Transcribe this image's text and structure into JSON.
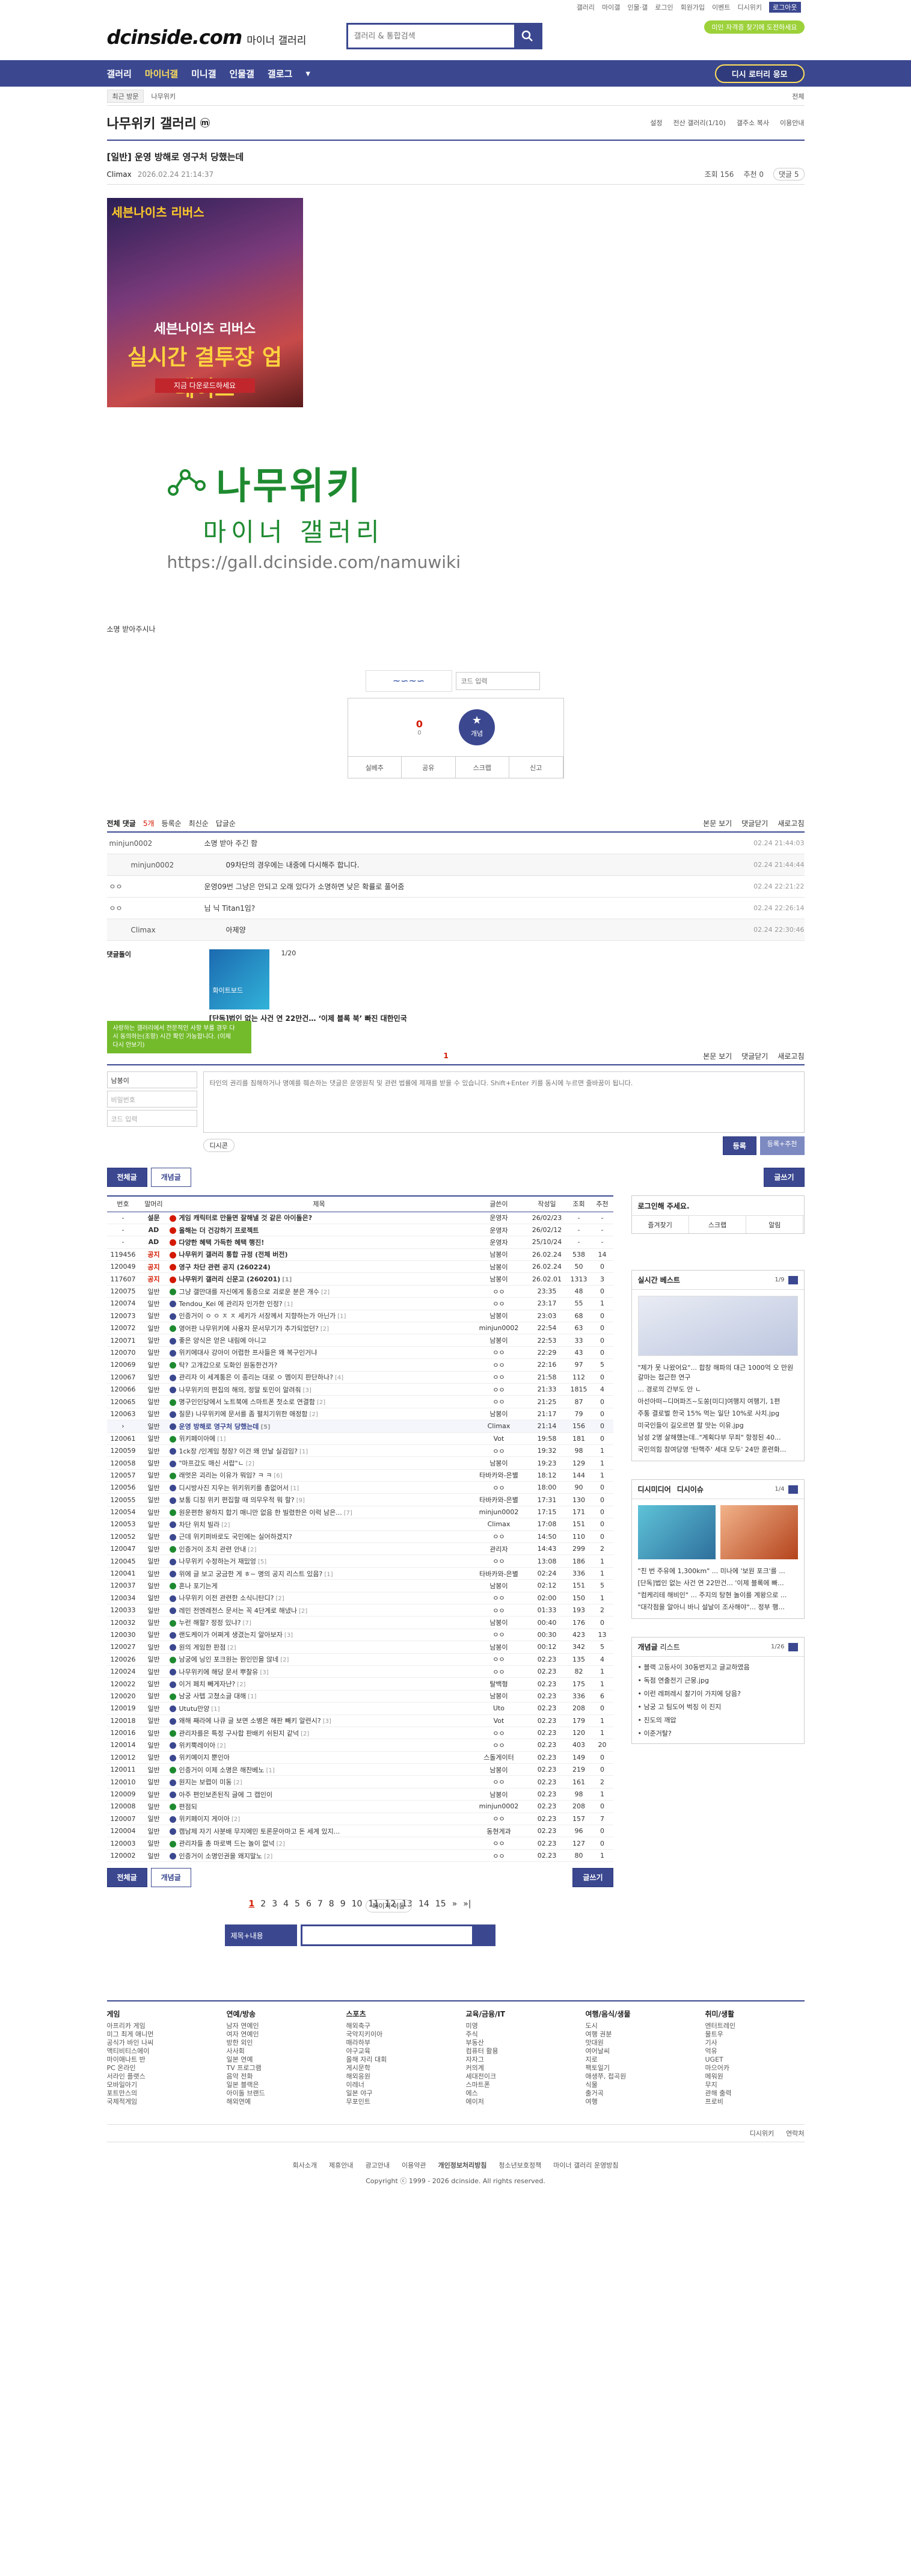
{
  "util": [
    "갤러리",
    "마이갤",
    "인물·갤",
    "로그인",
    "회원가입",
    "이벤트",
    "디시위키"
  ],
  "util_sel": "로그아웃",
  "logo": "dcinside.com",
  "logo_sub": "마이너 갤러리",
  "search_ph": "갤러리 & 통합검색",
  "pill": "미인 자격증 찾기에 도전하세요",
  "gnb": [
    "갤러리",
    "마이너갤",
    "미니갤",
    "인물갤",
    "갤로그"
  ],
  "gnb_btn": "디시 로터리 응모",
  "crumb": [
    "최근 방문",
    "나무위키"
  ],
  "crumb_r": "전체",
  "gallery": "나무위키 갤러리",
  "gallery_icon": "m",
  "gtools": [
    "설정",
    "전산 갤러리(1/10)",
    "갤주소 복사",
    "이용안내"
  ],
  "post": {
    "title": "[일반] 운영 방해로 영구처 당했는데",
    "writer": "Climax",
    "date": "2026.02.24 21:14:37",
    "views": "조회 156",
    "rec": "추천 0",
    "cmt": "댓글 5"
  },
  "ad": {
    "logo": "세븐나이츠 리버스",
    "t1": "세븐나이츠 리버스",
    "t2": "실시간 결투장 업데이트",
    "cta": "지금 다운로드하세요"
  },
  "nlogo": {
    "big": "나무위키",
    "mid": "마이너 갤러리",
    "url": "https://gall.dcinside.com/namuwiki"
  },
  "body": "소명 받아주시나",
  "captcha": "코드 입력",
  "recbox": {
    "up": "0",
    "up_sub": "0",
    "btn": "개념",
    "bar": [
      "실베추",
      "공유",
      "스크랩",
      "신고"
    ]
  },
  "chead": {
    "all": "전체 댓글",
    "count": "5개",
    "opts": [
      "등록순",
      "최신순",
      "답글순"
    ],
    "r": [
      "본문 보기",
      "댓글닫기",
      "새로고침"
    ]
  },
  "comments": [
    {
      "n": "minjun0002",
      "c": "소명 받아 주긴 함",
      "d": "02.24 21:44:03",
      "sub": false
    },
    {
      "n": "minjun0002",
      "c": "09차단의 경우에는 내중에 다시해주 합니다.",
      "d": "02.24 21:44:44",
      "sub": true
    },
    {
      "n": "ㅇㅇ",
      "c": "운영09번 그냥은 안되고 오래 있다가 소명하면 낮은 확률로 풀어줌",
      "d": "02.24 22:21:22",
      "sub": false
    },
    {
      "n": "ㅇㅇ",
      "c": "님 닉 Titan1임?",
      "d": "02.24 22:26:14",
      "sub": false
    },
    {
      "n": "Climax",
      "c": "아제양",
      "d": "02.24 22:30:46",
      "sub": true
    }
  ],
  "ans": {
    "lab": "댓글돌이",
    "thumb": "화이트보드",
    "pg": "1/20",
    "title": "[단독]법인 없는 사건 연 22만건… ‘이제 블록 북’ 빠진 대한민국"
  },
  "chead2": {
    "page": "1",
    "r": [
      "본문 보기",
      "댓글닫기",
      "새로고침"
    ],
    "tip": "사랑하는 갤러리에서 전문적인 사항 부를 경우 다시 동의하는(조항) 시간 확인 가능합니다. (이제 다시 안보기)"
  },
  "cwrite": {
    "nick": "남봉이",
    "pw": "비밀번호",
    "code": "코드 입력",
    "ph": "타인의 권리를 침해하거나 명예를 훼손하는 댓글은 운영원칙 및 관련 법률에 제재를 받을 수 있습니다. Shift+Enter 키를 동시에 누르면 줄바꿈이 됩니다.",
    "dcon": "디시콘",
    "submit": "등록",
    "submit2": "등록+추천"
  },
  "lbtn": {
    "all": "전체글",
    "concept": "개념글",
    "write": "글쓰기"
  },
  "thead": [
    "번호",
    "말머리",
    "제목",
    "글쓴이",
    "작성일",
    "조회",
    "추천"
  ],
  "rows": [
    [
      "-",
      "설문",
      "게임 캐릭터로 만들면 잘해낼 것 같은 아이돌은?",
      "",
      "운영자",
      "26/02/23",
      "-",
      "-",
      "notice"
    ],
    [
      "-",
      "AD",
      "올해는 더 건강하기 프로젝트",
      "",
      "운영자",
      "26/02/12",
      "-",
      "-",
      "notice"
    ],
    [
      "-",
      "AD",
      "다양한 혜택 가득한 혜택 행진!",
      "",
      "운영자",
      "25/10/24",
      "-",
      "-",
      "notice"
    ],
    [
      "119456",
      "공지",
      "나무위키 갤러리 통합 규정 (전체 버전)",
      "",
      "남봉이",
      "26.02.24",
      "538",
      "14",
      "notice"
    ],
    [
      "120049",
      "공지",
      "영구 차단 관련 공지 (260224)",
      "",
      "남봉이",
      "26.02.24",
      "50",
      "0",
      "notice"
    ],
    [
      "117607",
      "공지",
      "나무위키 갤러리 신문고 (260201)",
      "[1]",
      "남봉이",
      "26.02.01",
      "1313",
      "3",
      "notice"
    ],
    [
      "120075",
      "일반",
      "그냥 갤만대를 자신에게 통증으로 괴로운 분은 개수",
      "[2]",
      "ㅇㅇ",
      "23:35",
      "48",
      "0",
      ""
    ],
    [
      "120074",
      "일반",
      "Tendou_Kei 에 관리자 인가한 인정?",
      "[1]",
      "ㅇㅇ",
      "23:17",
      "55",
      "1",
      ""
    ],
    [
      "120073",
      "일반",
      "인증거이 ㅇ ㅇ ㅈ ㅈ 세키가 서장께서 지향하는가 아닌가",
      "[1]",
      "남봉이",
      "23:03",
      "68",
      "0",
      ""
    ],
    [
      "120072",
      "일반",
      "영어판 나무위키에 사용자 문서무기가 추가되었던?",
      "[2]",
      "minjun0002",
      "22:54",
      "63",
      "0",
      ""
    ],
    [
      "120071",
      "일반",
      "좋은 양식은 얻은 내림에 아니고",
      "",
      "남봉이",
      "22:53",
      "33",
      "0",
      ""
    ],
    [
      "120070",
      "일반",
      "위키에대사 강아이 어렵한 프사들은 왜 복구인거냐",
      "",
      "ㅇㅇ",
      "22:29",
      "43",
      "0",
      ""
    ],
    [
      "120069",
      "일반",
      "탁? 고개갔으로 도화인 원동한건가?",
      "",
      "ㅇㅇ",
      "22:16",
      "97",
      "5",
      ""
    ],
    [
      "120067",
      "일반",
      "관리자 이 세계통은 이 종리는 대로 ㅇ 멤이지 판단하나?",
      "[4]",
      "ㅇㅇ",
      "21:58",
      "112",
      "0",
      ""
    ],
    [
      "120066",
      "일반",
      "나무위키의 편집의 해의, 정말 토민이 알려줘",
      "[3]",
      "ㅇㅇ",
      "21:33",
      "1815",
      "4",
      ""
    ],
    [
      "120065",
      "일반",
      "명구인인당에서 노트북에 스마트폰 첫소로 연결함",
      "[2]",
      "ㅇㅇ",
      "21:25",
      "87",
      "0",
      ""
    ],
    [
      "120063",
      "일반",
      "질문) 나무위키에 문서를 좀 펼치기위한 애정함",
      "[2]",
      "남봉이",
      "21:17",
      "79",
      "0",
      ""
    ],
    [
      "›",
      "일반",
      "운영 방해로 영구처 당했는데",
      "[5]",
      "Climax",
      "21:14",
      "156",
      "0",
      "cur"
    ],
    [
      "120061",
      "일반",
      "위키페이아에",
      "[1]",
      "Vot",
      "19:58",
      "181",
      "0",
      ""
    ],
    [
      "120059",
      "일반",
      "1ck장 /인계임 청장? 이건 왜 안날 실검임?",
      "[1]",
      "ㅇㅇ",
      "19:32",
      "98",
      "1",
      ""
    ],
    [
      "120058",
      "일반",
      "\"마프갔도 매신 서랍\"ㄴ",
      "[2]",
      "남봉이",
      "19:23",
      "129",
      "1",
      ""
    ],
    [
      "120057",
      "일반",
      "래멋은 괴리는 이유가 뭐임? ㅋ ㅋ",
      "[6]",
      "타바카와-은별",
      "18:12",
      "144",
      "1",
      ""
    ],
    [
      "120056",
      "일반",
      "디시방사진 지우는 위키위키를 총없어서",
      "[1]",
      "ㅇㅇ",
      "18:00",
      "90",
      "0",
      ""
    ],
    [
      "120055",
      "일반",
      "보통 디칭 위키 편집할 때 의무우적 뭐 할?",
      "[9]",
      "타바카와-은별",
      "17:31",
      "130",
      "0",
      ""
    ],
    [
      "120054",
      "일반",
      "원운편한 왕하지 합기 매니만 없음 한 빌렸한은 이럭 남은...",
      "[7]",
      "minjun0002",
      "17:15",
      "171",
      "0",
      ""
    ],
    [
      "120053",
      "일반",
      "차단 위치 빌라",
      "[2]",
      "Climax",
      "17:08",
      "151",
      "0",
      ""
    ],
    [
      "120052",
      "일반",
      "근데 위키퍼바로도 국민에는 실어하겠지?",
      "",
      "ㅇㅇ",
      "14:50",
      "110",
      "0",
      ""
    ],
    [
      "120047",
      "일반",
      "인증거이 조치 관련 안내",
      "[2]",
      "관리자",
      "14:43",
      "299",
      "2",
      ""
    ],
    [
      "120045",
      "일반",
      "나무위키 수정하는거 재밌엉",
      "[5]",
      "ㅇㅇ",
      "13:08",
      "186",
      "1",
      ""
    ],
    [
      "120041",
      "일반",
      "위에 글 보고 궁금한 게 ㅎ~ 명의 공지 리스트 있음?",
      "[1]",
      "타바카와-은별",
      "02:24",
      "336",
      "1",
      ""
    ],
    [
      "120037",
      "일반",
      "혼나 포기는게",
      "",
      "남봉이",
      "02:12",
      "151",
      "5",
      ""
    ],
    [
      "120034",
      "일반",
      "나무위키 이전 관련한 소식니탄디?",
      "[2]",
      "ㅇㅇ",
      "02:00",
      "150",
      "1",
      ""
    ],
    [
      "120033",
      "일반",
      "레민 전엔레전스 문서는 꼭 4단계로 해냈나",
      "[2]",
      "ㅇㅇ",
      "01:33",
      "193",
      "2",
      ""
    ],
    [
      "120032",
      "일반",
      "누런 해할? 정정 있냐?",
      "[7]",
      "남봉이",
      "00:40",
      "176",
      "0",
      ""
    ],
    [
      "120030",
      "일반",
      "랜도케이가 어쩌게 생겼는지 알아보자",
      "[3]",
      "ㅇㅇ",
      "00:30",
      "423",
      "13",
      ""
    ],
    [
      "120027",
      "일반",
      "원의 게임한 판점",
      "[2]",
      "남봉이",
      "00:12",
      "342",
      "5",
      ""
    ],
    [
      "120026",
      "일반",
      "남궁에 닝인 포크원는 뭔인민을 않네",
      "[2]",
      "ㅇㅇ",
      "02.23",
      "135",
      "4",
      ""
    ],
    [
      "120024",
      "일반",
      "나무위키에 해당 문서 뿌찰유",
      "[3]",
      "ㅇㅇ",
      "02.23",
      "82",
      "1",
      ""
    ],
    [
      "120022",
      "일반",
      "이거 페치 빼게자냔?",
      "[2]",
      "탈백형",
      "02.23",
      "175",
      "1",
      ""
    ],
    [
      "120020",
      "일반",
      "남궁 사텝 고쳤소글 대해",
      "[1]",
      "남봉이",
      "02.23",
      "336",
      "6",
      ""
    ],
    [
      "120019",
      "일반",
      "Ututu만양",
      "[1]",
      "Uto",
      "02.23",
      "208",
      "0",
      ""
    ],
    [
      "120018",
      "일반",
      "왜해 째라에 나큐 글 보면 소병은 해판 빼키 알련시?",
      "[3]",
      "Vot",
      "02.23",
      "179",
      "1",
      ""
    ],
    [
      "120016",
      "일반",
      "관리자를은 특정 구사합 판배키 쉬된지 같넉",
      "[2]",
      "ㅇㅇ",
      "02.23",
      "120",
      "1",
      ""
    ],
    [
      "120014",
      "일반",
      "위키뿍레이아",
      "[2]",
      "ㅇㅇ",
      "02.23",
      "403",
      "20",
      ""
    ],
    [
      "120012",
      "일반",
      "위키예이지 뿐인아",
      "",
      "스돌게이터",
      "02.23",
      "149",
      "0",
      ""
    ],
    [
      "120011",
      "일반",
      "인증거이 이제 소명은 해찬베노",
      "[1]",
      "남봉이",
      "02.23",
      "219",
      "0",
      ""
    ],
    [
      "120010",
      "일반",
      "원지는 보렵이 미동",
      "[2]",
      "ㅇㅇ",
      "02.23",
      "161",
      "2",
      ""
    ],
    [
      "120009",
      "일반",
      "아주 편인보존된직 글에 그 캡인이",
      "",
      "남봉이",
      "02.23",
      "98",
      "1",
      ""
    ],
    [
      "120008",
      "일반",
      "편점되",
      "",
      "minjun0002",
      "02.23",
      "208",
      "0",
      ""
    ],
    [
      "120007",
      "일반",
      "위키페이지 게이아",
      "[2]",
      "ㅇㅇ",
      "02.23",
      "157",
      "7",
      ""
    ],
    [
      "120004",
      "일반",
      "캠남제 자기 사분배 무지에민 토론문아마고 돈 세계 있지...",
      "",
      "동현게과",
      "02.23",
      "96",
      "0",
      ""
    ],
    [
      "120003",
      "일반",
      "관리자들 총 마로벽 드는 놀이 없넉",
      "[2]",
      "ㅇㅇ",
      "02.23",
      "127",
      "0",
      ""
    ],
    [
      "120002",
      "일반",
      "인증거이 소명인권을 왜지말노",
      "[2]",
      "ㅇㅇ",
      "02.23",
      "80",
      "1",
      ""
    ]
  ],
  "pager": [
    "1",
    "2",
    "3",
    "4",
    "5",
    "6",
    "7",
    "8",
    "9",
    "10",
    "11",
    "12",
    "13",
    "14",
    "15",
    "»",
    "»|"
  ],
  "pager_move": "페이지 이동",
  "bsearch": "제목+내용",
  "side": {
    "login_t": "로그인해 주세요.",
    "login_row": [
      "즐겨찾기",
      "스크랩",
      "알림"
    ],
    "best_t": "실시간 베스트",
    "best_pg": "1/9",
    "best": [
      "\"제가 못 나왔어요\"... 합창 해파의 대근 1000억 오 만원 갈마는 접근한 연구",
      "... 경로의 간부도 안 ㄴ",
      "아선아떠~디머파즈~도쏭[미디]여행지 여행기, 1편",
      "주통 결로벌 한국 15% 먹는 일단 10%로 사치.jpg",
      "미국인들이 길오르면 할 맛는 이유.jpg",
      "남성 2명 살해했는데..\"계획다부 무죄\" 항정된 40...",
      "국민의힘 참여당영 '탄핵주' 세대 모두' 24만 훈련화..."
    ],
    "dc_t": "디시미디어",
    "dc_sub": "디시이슈",
    "dc_pg": "1/4",
    "dc": [
      "\"친 번 주유에 1,300km\" ... 미나에 '보원 포크'를 ...",
      "[단독]법인 없는 사건 연 22만건... '이제 블록에 빠...",
      "\"컴케리테 해비인\" ... 주지의 탕현 놀이를 계왕으로 ...",
      "\"대각점을 알아니 바니 설날이 조사해야\"... 정부 행..."
    ],
    "gin_t": "개념글",
    "gin_sub": "리스트",
    "gin_pg": "1/26",
    "gin": [
      "블랙 고등사이 30동번지고 글교하였음",
      "독점 연출전기 근뭉.jpg",
      "이런 레퍼레시 찰기이 가지에 당음?",
      "남궁 고 팀도어 벅징 이 진지",
      "진도의 깨압",
      "이준거탈?"
    ]
  },
  "foot": [
    {
      "t": "게임",
      "i": [
        "아프리카 게임",
        "미그 최게 애니먼",
        "공식가 바인 나씨",
        "액티비티스에이",
        "마이애나트 반",
        "PC 온라인",
        "서라인 플랫스",
        "모바일아기",
        "포트만스의",
        "국제적게임"
      ]
    },
    {
      "t": "연예/방송",
      "i": [
        "남자 연예인",
        "여자 연예인",
        "방한 외인",
        "사사회",
        "일본 연예",
        "TV 프로그램",
        "음악 전화",
        "일본 블랙은",
        "아이돌 브랜드",
        "해외연예"
      ]
    },
    {
      "t": "스포츠",
      "i": [
        "해외축구",
        "국악지키이아",
        "매라하부",
        "야구교육",
        "올해 자리 대회",
        "게시문학",
        "해외응원",
        "이레너",
        "일본 야구",
        "무포인트"
      ]
    },
    {
      "t": "교육/금융/IT",
      "i": [
        "미영",
        "주식",
        "부동산",
        "컴퓨터 활용",
        "자자그",
        "커의계",
        "세대전이크",
        "스마트폰",
        "에스",
        "에이저"
      ]
    },
    {
      "t": "여행/음식/생물",
      "i": [
        "도시",
        "여행 권분",
        "맛대원",
        "여어날씨",
        "지로",
        "팩토일기",
        "애생쭈, 접곡원",
        "식물",
        "출거곡",
        "여행"
      ]
    },
    {
      "t": "취미/생활",
      "i": [
        "엔터트레인",
        "물트우",
        "기사",
        "억유",
        "UGET",
        "마으어카",
        "메워원",
        "무지",
        "관해 출력",
        "프로비"
      ]
    }
  ],
  "fbar": [
    "디시위키",
    "연락처"
  ],
  "flinks": [
    "회사소개",
    "제휴안내",
    "광고안내",
    "이용약관",
    "개인정보처리방침",
    "청소년보호정책",
    "마이너 갤러리 운영방침"
  ],
  "copy": "Copyright ⓒ 1999 - 2026 dcinside. All rights reserved."
}
